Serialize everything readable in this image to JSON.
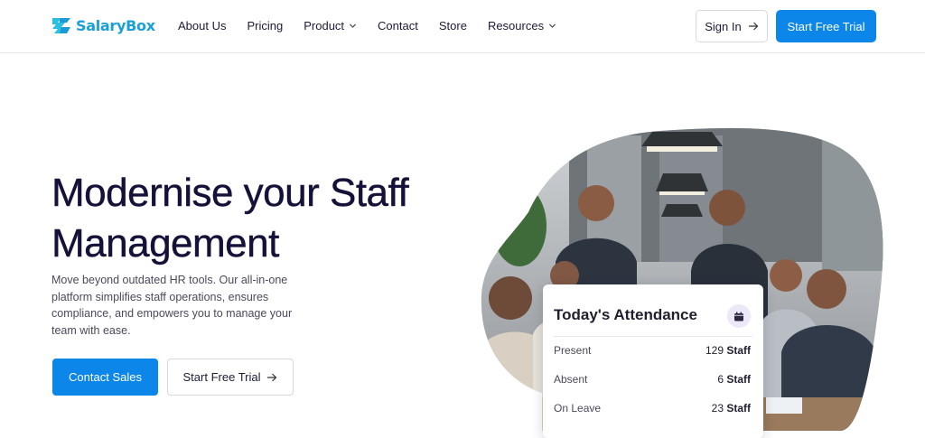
{
  "brand": {
    "name": "SalaryBox",
    "color": "#19a0d8",
    "accent": "#0d86ea"
  },
  "nav": {
    "items": [
      {
        "label": "About Us",
        "has_dropdown": false
      },
      {
        "label": "Pricing",
        "has_dropdown": false
      },
      {
        "label": "Product",
        "has_dropdown": true
      },
      {
        "label": "Contact",
        "has_dropdown": false
      },
      {
        "label": "Store",
        "has_dropdown": false
      },
      {
        "label": "Resources",
        "has_dropdown": true
      }
    ],
    "sign_in": "Sign In",
    "start_trial": "Start Free Trial"
  },
  "hero": {
    "title": "Modernise your Staff Management",
    "subtitle": "Move beyond outdated HR tools. Our all-in-one platform simplifies staff operations, ensures compliance, and empowers you to manage your team with ease.",
    "contact_sales": "Contact Sales",
    "start_trial": "Start Free Trial",
    "image_icon": "team-meeting-photo"
  },
  "attendance_card": {
    "title": "Today's Attendance",
    "icon": "calendar-icon",
    "rows": [
      {
        "label": "Present",
        "count": "129",
        "unit": "Staff"
      },
      {
        "label": "Absent",
        "count": "6",
        "unit": "Staff"
      },
      {
        "label": "On Leave",
        "count": "23",
        "unit": "Staff"
      }
    ]
  }
}
